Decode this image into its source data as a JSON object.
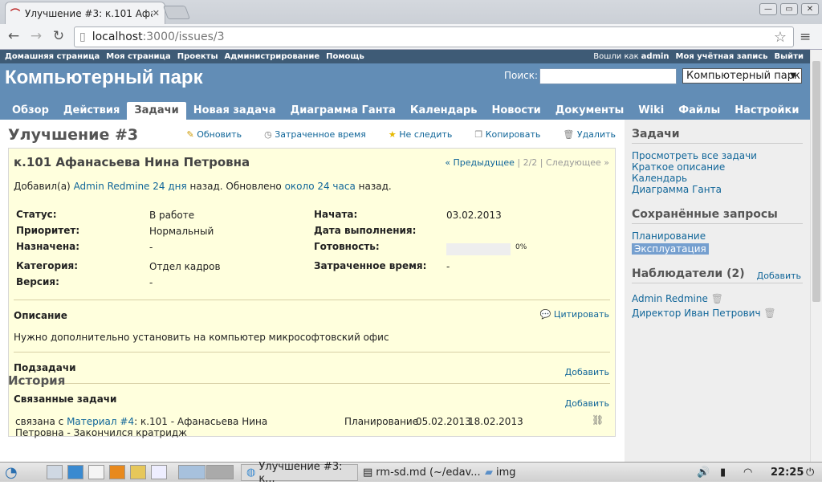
{
  "browser": {
    "tab_title": "Улучшение #3: к.101 Афа",
    "tab_close": "✕",
    "url_host": "localhost",
    "url_path": ":3000/issues/3",
    "back": "←",
    "forward": "→",
    "reload": "↻",
    "star": "☆",
    "menu": "≡",
    "win_min": "—",
    "win_max": "▭",
    "win_close": "✕"
  },
  "topmenu": {
    "items": [
      "Домашняя страница",
      "Моя страница",
      "Проекты",
      "Администрирование",
      "Помощь"
    ],
    "logged_as": "Вошли как",
    "user": "admin",
    "account": "Моя учётная запись",
    "logout": "Выйти"
  },
  "header": {
    "title": "Компьютерный парк",
    "search_label": "Поиск:",
    "project_select": "Компьютерный парк",
    "select_arrow": "▼"
  },
  "tabs": [
    "Обзор",
    "Действия",
    "Задачи",
    "Новая задача",
    "Диаграмма Ганта",
    "Календарь",
    "Новости",
    "Документы",
    "Wiki",
    "Файлы",
    "Настройки"
  ],
  "issue": {
    "title": "Улучшение #3",
    "actions": [
      "Обновить",
      "Затраченное время",
      "Не следить",
      "Копировать",
      "Удалить"
    ],
    "subject": "к.101 Афанасьева Нина Петровна",
    "prev": "« Предыдущее",
    "count": "2/2",
    "next": "Следующее »",
    "sep": "|",
    "added_by": "Добавил(а)",
    "author": "Admin Redmine",
    "added_ago": "24 дня",
    "added_ago_suffix": "назад. Обновлено",
    "updated_ago": "около 24 часа",
    "updated_suffix": "назад.",
    "attrs_left": [
      {
        "label": "Статус:",
        "value": "В работе"
      },
      {
        "label": "Приоритет:",
        "value": "Нормальный"
      },
      {
        "label": "Назначена:",
        "value": "-"
      },
      {
        "label": "Категория:",
        "value": "Отдел кадров"
      },
      {
        "label": "Версия:",
        "value": "-"
      }
    ],
    "attrs_right": [
      {
        "label": "Начата:",
        "value": "03.02.2013"
      },
      {
        "label": "Дата выполнения:",
        "value": ""
      },
      {
        "label": "Готовность:",
        "value": "0%"
      },
      {
        "label": "Затраченное время:",
        "value": "-"
      }
    ],
    "done_ratio": 0,
    "description_label": "Описание",
    "quote": "Цитировать",
    "description": "Нужно дополнительно установить на компьютер микрософтовский офис",
    "subtasks_label": "Подзадачи",
    "add": "Добавить",
    "related_label": "Связанные задачи",
    "relation": {
      "text1": "связана с",
      "link": "Материал #4",
      "text2": "к.101 - Афанасьева Нина Петровна - Закончился кратридж",
      "status": "Планирование",
      "start": "05.02.2013",
      "due": "18.02.2013"
    },
    "history": "История"
  },
  "sidebar": {
    "tasks_title": "Задачи",
    "links": [
      "Просмотреть все задачи",
      "Краткое описание",
      "Календарь",
      "Диаграмма Ганта"
    ],
    "saved_title": "Сохранённые запросы",
    "queries": [
      "Планирование",
      "Эксплуатация"
    ],
    "watchers_title": "Наблюдатели (2)",
    "watchers_add": "Добавить",
    "watchers": [
      "Admin Redmine",
      "Директор Иван Петрович"
    ]
  },
  "taskbar": {
    "apps": [
      "Улучшение #3: к...",
      "rm-sd.md (~/edav...",
      "img"
    ],
    "time": "22:25"
  }
}
